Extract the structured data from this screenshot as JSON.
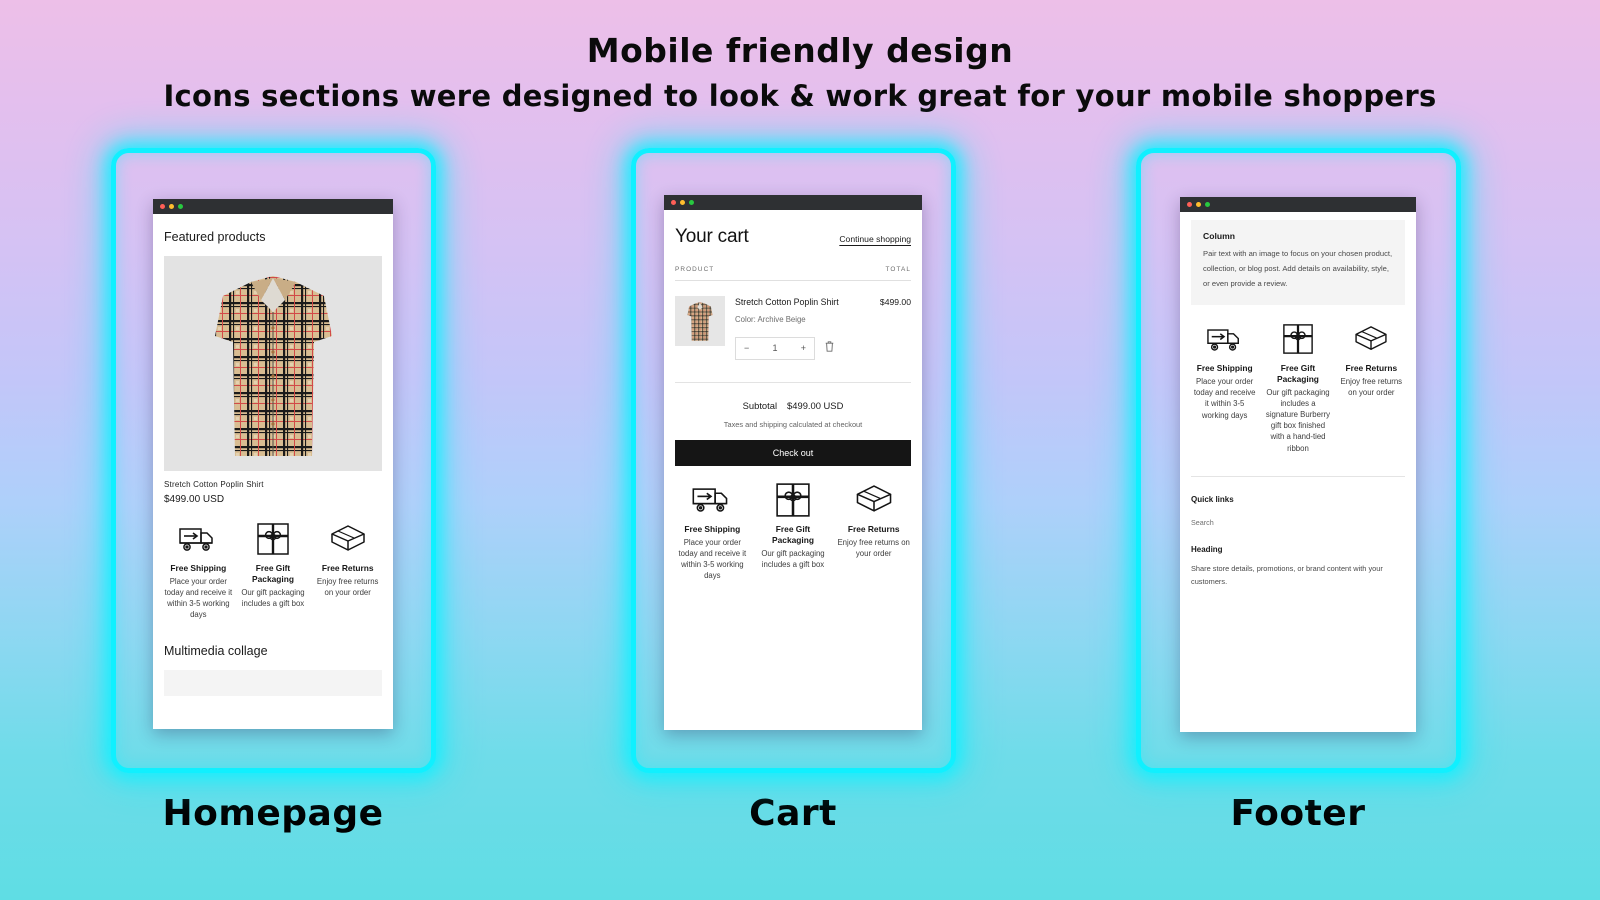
{
  "header": {
    "title": "Mobile friendly design",
    "subtitle": "Icons sections were designed to look & work great for your mobile shoppers"
  },
  "theme": {
    "neon": "#10f0ff",
    "gradient_top": "#edbfe8",
    "gradient_mid": "#aed0fa",
    "gradient_bottom": "#5fdde4",
    "button_dark": "#151515"
  },
  "features": {
    "shipping": {
      "icon": "delivery-truck-icon",
      "title": "Free Shipping",
      "text": "Place your order today and receive it within 3-5 working days"
    },
    "gift": {
      "icon": "gift-box-icon",
      "title": "Free Gift Packaging",
      "text_short": "Our gift packaging includes a gift box",
      "text_long": "Our gift packaging includes a signature Burberry gift box finished with a hand-tied ribbon"
    },
    "returns": {
      "icon": "open-box-icon",
      "title": "Free Returns",
      "text": "Enjoy free returns on your order"
    }
  },
  "mockups": [
    {
      "caption": "Homepage",
      "section_title": "Featured products",
      "product": {
        "name": "Stretch Cotton Poplin Shirt",
        "price": "$499.00 USD"
      },
      "multimedia_title": "Multimedia collage"
    },
    {
      "caption": "Cart",
      "cart": {
        "title": "Your cart",
        "continue_link": "Continue shopping",
        "col_product": "PRODUCT",
        "col_total": "TOTAL",
        "product_name": "Stretch Cotton Poplin Shirt",
        "product_price": "$499.00",
        "variant": "Color: Archive Beige",
        "qty_minus": "−",
        "qty_value": "1",
        "qty_plus": "+",
        "remove_icon": "trash-icon",
        "subtotal_label": "Subtotal",
        "subtotal_value": "$499.00 USD",
        "tax_note": "Taxes and shipping calculated at checkout",
        "checkout_label": "Check out"
      }
    },
    {
      "caption": "Footer",
      "footer": {
        "column_title": "Column",
        "column_text": "Pair text with an image to focus on your chosen product, collection, or blog post. Add details on availability, style, or even provide a review.",
        "quick_links_title": "Quick links",
        "quick_link_search": "Search",
        "heading_title": "Heading",
        "heading_text": "Share store details, promotions, or brand content with your customers."
      }
    }
  ]
}
